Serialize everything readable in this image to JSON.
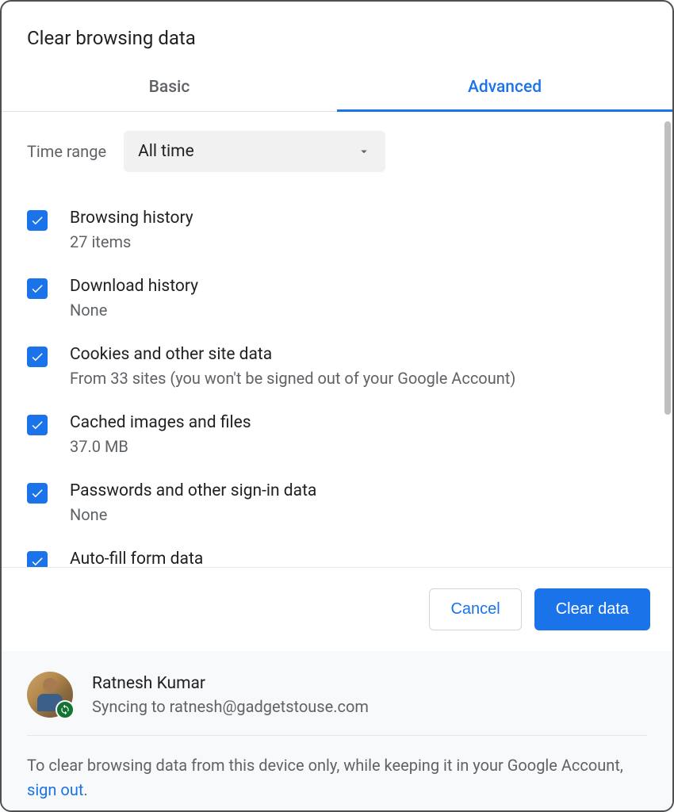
{
  "dialog": {
    "title": "Clear browsing data"
  },
  "tabs": {
    "basic": "Basic",
    "advanced": "Advanced",
    "active": "advanced"
  },
  "timeRange": {
    "label": "Time range",
    "value": "All time"
  },
  "items": [
    {
      "title": "Browsing history",
      "sub": "27 items",
      "checked": true
    },
    {
      "title": "Download history",
      "sub": "None",
      "checked": true
    },
    {
      "title": "Cookies and other site data",
      "sub": "From 33 sites (you won't be signed out of your Google Account)",
      "checked": true
    },
    {
      "title": "Cached images and files",
      "sub": "37.0 MB",
      "checked": true
    },
    {
      "title": "Passwords and other sign-in data",
      "sub": "None",
      "checked": true
    },
    {
      "title": "Auto-fill form data",
      "sub": "",
      "checked": true
    }
  ],
  "buttons": {
    "cancel": "Cancel",
    "clear": "Clear data"
  },
  "account": {
    "name": "Ratnesh Kumar",
    "status": "Syncing to ratnesh@gadgetstouse.com"
  },
  "notice": {
    "prefix": "To clear browsing data from this device only, while keeping it in your Google Account, ",
    "link": "sign out",
    "suffix": "."
  },
  "colors": {
    "accent": "#1a73e8",
    "textPrimary": "#202124",
    "textSecondary": "#5f6368"
  }
}
